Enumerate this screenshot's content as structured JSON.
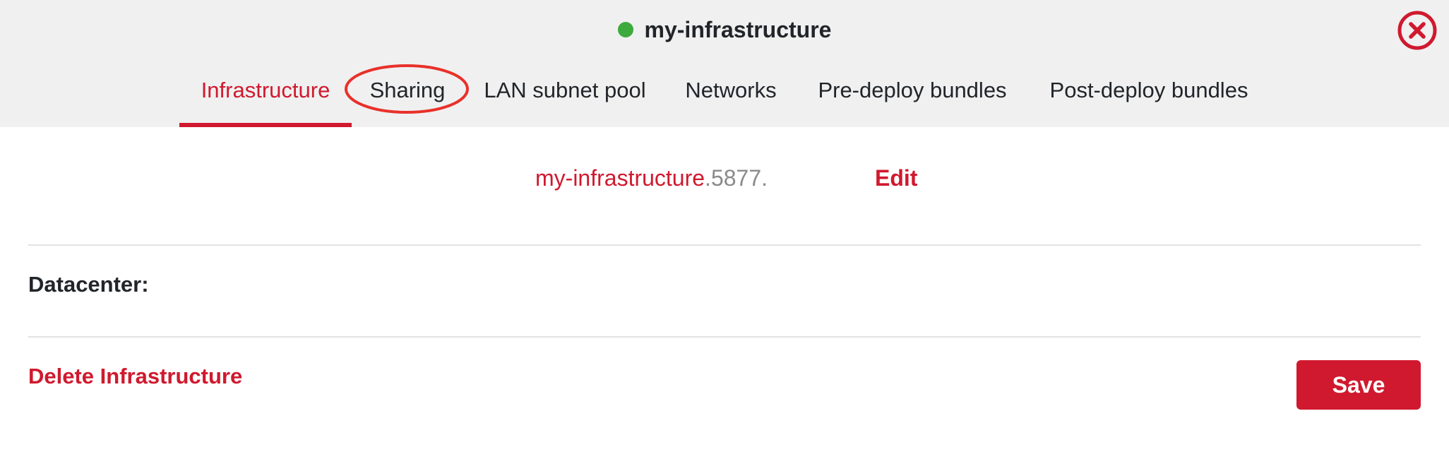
{
  "header": {
    "title": "my-infrastructure",
    "status_color": "#3caa3c",
    "close_icon": "close-circle-icon"
  },
  "tabs": [
    {
      "label": "Infrastructure",
      "active": true
    },
    {
      "label": "Sharing",
      "active": false,
      "highlighted": true
    },
    {
      "label": "LAN subnet pool",
      "active": false
    },
    {
      "label": "Networks",
      "active": false
    },
    {
      "label": "Pre-deploy bundles",
      "active": false
    },
    {
      "label": "Post-deploy bundles",
      "active": false
    }
  ],
  "infrastructure": {
    "name_prefix": "my-infrastructure",
    "name_suffix": ".5877.",
    "edit_label": "Edit"
  },
  "datacenter": {
    "label": "Datacenter:"
  },
  "actions": {
    "delete_label": "Delete Infrastructure",
    "save_label": "Save"
  },
  "colors": {
    "accent": "#d0192e",
    "header_bg": "#f0f0f0",
    "highlight_ring": "#e8312a"
  }
}
